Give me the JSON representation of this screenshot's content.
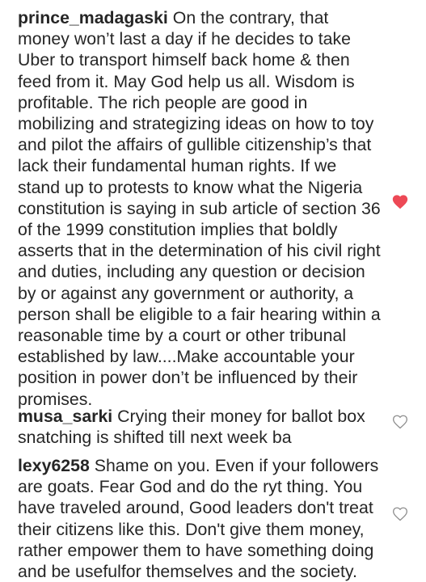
{
  "comments": [
    {
      "username": "prince_madagaski",
      "text": "On the contrary, that money won’t last a day if he decides to take Uber to transport himself back home & then feed from it. May God help us all. Wisdom is profitable. The rich people are good in mobilizing and strategizing ideas on how to toy and pilot the affairs of gullible citizenship’s that lack their fundamental human rights. If we stand up to protests to know what the Nigeria constitution is saying in sub article of section 36 of the 1999 constitution implies that boldly asserts that in the determination of his civil right and duties, including any question or decision by or against any government or authority, a person shall be eligible to a fair hearing within a reasonable time by a court or other tribunal established by law....Make accountable your position in power don’t be influenced by their promises.",
      "liked": true
    },
    {
      "username": "musa_sarki",
      "text": "Crying their money for ballot box snatching is shifted till next week ba",
      "liked": false
    },
    {
      "username": "lexy6258",
      "text": "Shame on you. Even if your followers are goats. Fear God and do the ryt thing. You have traveled around, Good leaders don't treat their citizens like this. Don't give them money, rather empower them to have something doing and be usefulfor themselves and the society.",
      "liked": false
    }
  ],
  "colors": {
    "text": "#262626",
    "heart_liked": "#ed4956",
    "heart_outline": "#8e8e8e",
    "background": "#ffffff"
  }
}
